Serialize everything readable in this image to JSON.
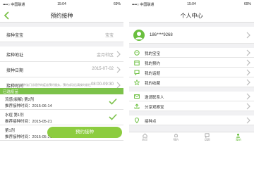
{
  "left": {
    "status": {
      "carrier": "••••○ 中国联通",
      "time": "15:04",
      "battery": "69%"
    },
    "title": "预约接种",
    "form": [
      {
        "label": "接种宝宝",
        "value": "宝宝"
      },
      {
        "label": "接种地址",
        "value": "金月社区"
      },
      {
        "label": "接种日期",
        "value": "2015-07-02"
      },
      {
        "label": "接种时间",
        "value": "08:00-09:30"
      }
    ],
    "notice": "注：目前仅接种该门诊提供的疫苗预约服务，预约成功后请按时前往",
    "section_title": "已选疫苗",
    "vaccines": [
      {
        "name": "流感(裂解) 第2剂",
        "recommend": "推荐接种时间：",
        "date": "2015-06-14"
      },
      {
        "name": "水痘 第1剂",
        "recommend": "推荐接种时间：",
        "date": "2015-05-21"
      },
      {
        "name": "第1剂",
        "recommend": "推荐接种时间：",
        "date": "2015-05-21"
      }
    ],
    "submit_label": "预约接种",
    "accent": "#7cc24a"
  },
  "right": {
    "status": {
      "carrier": "••••○ 中国联通",
      "time": "15:04",
      "battery": "69%"
    },
    "title": "个人中心",
    "phone": "186****9268",
    "menu_group1": [
      {
        "label": "我的宝宝",
        "icon": "baby-icon"
      },
      {
        "label": "我的预约",
        "icon": "calendar-icon"
      },
      {
        "label": "我的话题",
        "icon": "chat-icon"
      },
      {
        "label": "我的收藏",
        "icon": "star-icon"
      }
    ],
    "menu_group2": [
      {
        "label": "邀请联系人",
        "icon": "mail-icon"
      },
      {
        "label": "分享观察宝",
        "icon": "share-icon"
      },
      {
        "label": "接种点",
        "icon": "location-icon"
      }
    ],
    "tabs": [
      {
        "label": "首页",
        "icon": "home-icon"
      },
      {
        "label": "预约",
        "icon": "bell-icon"
      },
      {
        "label": "话题",
        "icon": "chat-icon"
      },
      {
        "label": "我的",
        "icon": "user-icon"
      }
    ],
    "accent": "#6abf3e"
  }
}
